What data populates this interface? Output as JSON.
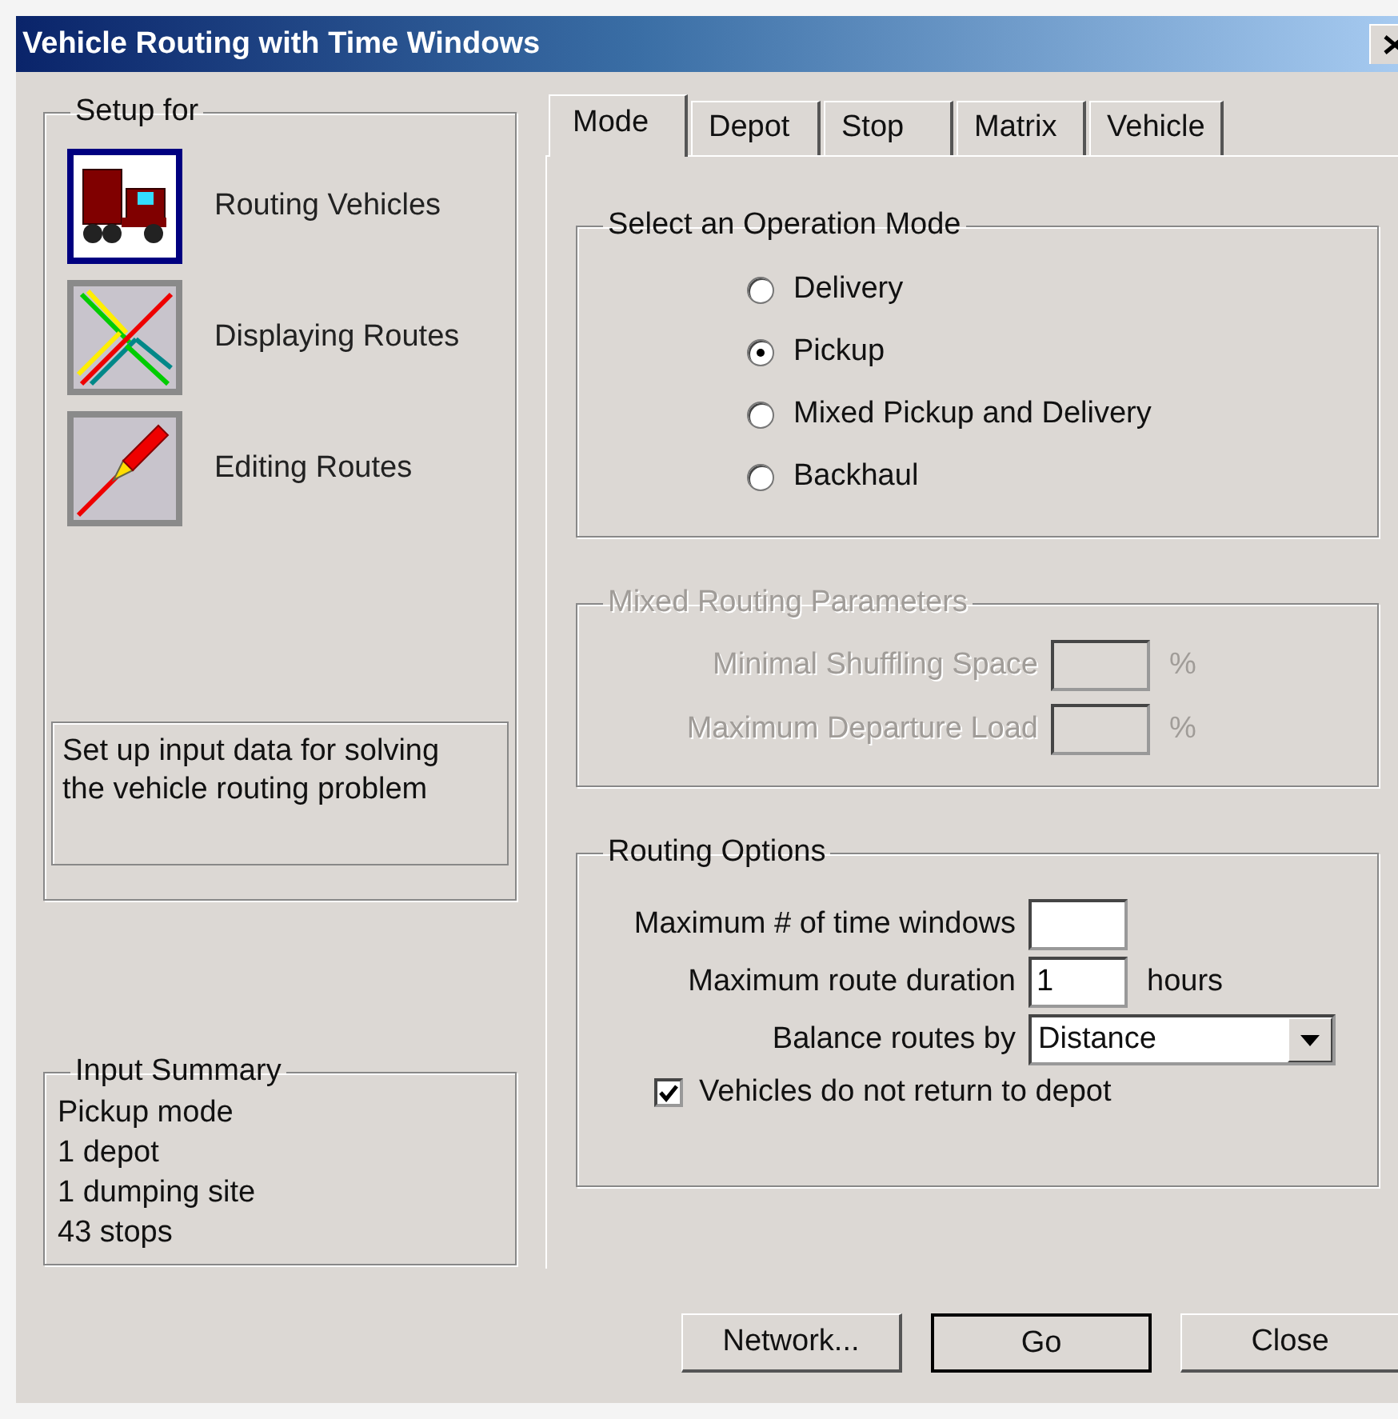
{
  "window": {
    "title": "Vehicle Routing with Time Windows"
  },
  "setup": {
    "title": "Setup for",
    "items": [
      {
        "label": "Routing Vehicles",
        "selected": true
      },
      {
        "label": "Displaying Routes",
        "selected": false
      },
      {
        "label": "Editing Routes",
        "selected": false
      }
    ],
    "description": "Set up input data for solving the vehicle routing problem"
  },
  "summary": {
    "title": "Input Summary",
    "lines": [
      "Pickup mode",
      "1 depot",
      "1 dumping site",
      "43 stops"
    ]
  },
  "tabs": [
    {
      "label": "Mode",
      "selected": true
    },
    {
      "label": "Depot",
      "selected": false
    },
    {
      "label": "Stop",
      "selected": false
    },
    {
      "label": "Matrix",
      "selected": false
    },
    {
      "label": "Vehicle",
      "selected": false
    }
  ],
  "operation_mode": {
    "title": "Select an Operation Mode",
    "options": [
      {
        "label": "Delivery",
        "selected": false
      },
      {
        "label": "Pickup",
        "selected": true
      },
      {
        "label": "Mixed Pickup and Delivery",
        "selected": false
      },
      {
        "label": "Backhaul",
        "selected": false
      }
    ]
  },
  "mixed_parameters": {
    "title": "Mixed Routing Parameters",
    "disabled": true,
    "fields": [
      {
        "label": "Minimal Shuffling Space",
        "unit": "%"
      },
      {
        "label": "Maximum Departure Load",
        "unit": "%"
      }
    ]
  },
  "routing_options": {
    "title": "Routing Options",
    "rows": [
      {
        "kind": "text",
        "label": "Maximum # of time windows"
      },
      {
        "kind": "text",
        "label": "Maximum route duration",
        "value": "1",
        "unit": "hours"
      },
      {
        "kind": "select",
        "label": "Balance routes by",
        "value": "Distance"
      },
      {
        "kind": "checkbox",
        "label": "Vehicles do not return to depot",
        "checked": true
      }
    ]
  },
  "buttons": [
    {
      "label": "Network...",
      "default": false
    },
    {
      "label": "Go",
      "default": true
    },
    {
      "label": "Close",
      "default": false
    }
  ]
}
